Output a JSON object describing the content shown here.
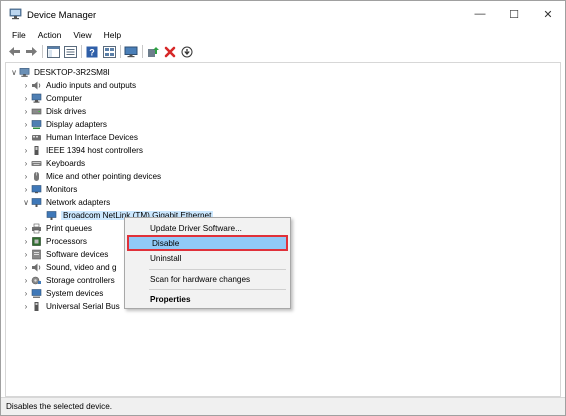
{
  "window": {
    "title": "Device Manager",
    "minimize": "—",
    "maximize": "☐",
    "close": "✕"
  },
  "menu": [
    "File",
    "Action",
    "View",
    "Help"
  ],
  "toolbar": {
    "buttons": [
      "back-icon",
      "forward-icon",
      "show-hide-console-tree-icon",
      "properties-icon",
      "help-icon",
      "view-icon",
      "monitor-icon",
      "update-driver-icon",
      "uninstall-icon",
      "scan-for-hardware-icon"
    ]
  },
  "tree": {
    "root": "DESKTOP-3R2SM8I",
    "categories": [
      "Audio inputs and outputs",
      "Computer",
      "Disk drives",
      "Display adapters",
      "Human Interface Devices",
      "IEEE 1394 host controllers",
      "Keyboards",
      "Mice and other pointing devices",
      "Monitors",
      "Network adapters",
      "Broadcom NetLink (TM) Gigabit Ethernet",
      "Print queues",
      "Processors",
      "Software devices",
      "Sound, video and g",
      "Storage controllers",
      "System devices",
      "Universal Serial Bus"
    ]
  },
  "context_menu": {
    "items": [
      "Update Driver Software...",
      "Disable",
      "Uninstall",
      "Scan for hardware changes",
      "Properties"
    ]
  },
  "status": "Disables the selected device.",
  "colors": {
    "selection": "#cce8ff",
    "menu_highlight": "#91c9f7",
    "highlight_border": "#e0313a"
  }
}
